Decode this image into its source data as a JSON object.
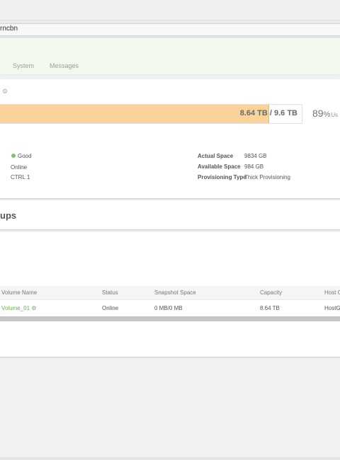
{
  "browser": {
    "url_fragment": "rncbn"
  },
  "nav": {
    "tabs": [
      {
        "label": "System"
      },
      {
        "label": "Messages"
      }
    ]
  },
  "capacity": {
    "used_label": "8.64 TB / 9.6 TB",
    "used_fraction": 0.89,
    "percent_value": "89",
    "percent_sign": "%",
    "used_suffix": "Us"
  },
  "details": {
    "status": "Good",
    "state": "Online",
    "controller": "CTRL 1",
    "rows": [
      {
        "key": "Actual Space",
        "value": "9834 GB"
      },
      {
        "key": "Available Space",
        "value": "984 GB"
      },
      {
        "key": "Provisioning Type",
        "value": "Thick Provisioning"
      }
    ]
  },
  "section": {
    "title_fragment": "ups"
  },
  "volumes": {
    "columns": [
      "Volume Name",
      "Status",
      "Snapshot Space",
      "Capacity",
      "Host C"
    ],
    "rows": [
      {
        "name": "Volume_01",
        "status": "Online",
        "snapshot": "0 MB/0 MB",
        "capacity": "8.64 TB",
        "host": "HostG"
      }
    ]
  },
  "colors": {
    "accent_green": "#6ab04c",
    "capacity_fill": "#f9d39a",
    "status_good": "#7dc36b"
  },
  "icons": {
    "settings": "gear-icon",
    "status": "status-dot-icon"
  }
}
